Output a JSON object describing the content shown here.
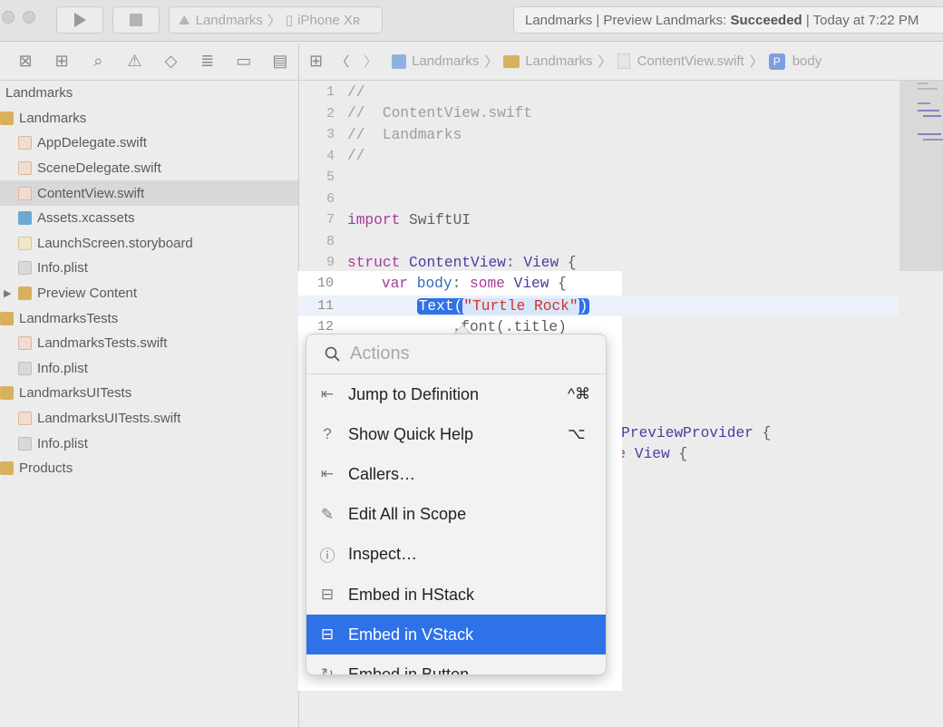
{
  "toolbar": {
    "run_icon": "play-icon",
    "stop_icon": "stop-icon",
    "scheme": "Landmarks",
    "device": "iPhone Xʀ",
    "activity_prefix": "Landmarks | Preview Landmarks: ",
    "activity_status": "Succeeded",
    "activity_suffix": " | Today at 7:22 PM"
  },
  "navigator_icons": [
    "folder-icon",
    "hierarchy-icon",
    "search-icon",
    "warning-icon",
    "test-icon",
    "debug-icon",
    "breakpoint-icon",
    "report-icon"
  ],
  "sidebar": {
    "items": [
      {
        "label": "Landmarks",
        "indent": 0,
        "icon": "project",
        "selected": false
      },
      {
        "label": "Landmarks",
        "indent": 0,
        "icon": "folder",
        "selected": false
      },
      {
        "label": "AppDelegate.swift",
        "indent": 1,
        "icon": "swift",
        "selected": false
      },
      {
        "label": "SceneDelegate.swift",
        "indent": 1,
        "icon": "swift",
        "selected": false
      },
      {
        "label": "ContentView.swift",
        "indent": 1,
        "icon": "swift",
        "selected": true
      },
      {
        "label": "Assets.xcassets",
        "indent": 1,
        "icon": "asset",
        "selected": false
      },
      {
        "label": "LaunchScreen.storyboard",
        "indent": 1,
        "icon": "story",
        "selected": false
      },
      {
        "label": "Info.plist",
        "indent": 1,
        "icon": "plist",
        "selected": false
      },
      {
        "label": "Preview Content",
        "indent": 1,
        "icon": "folder",
        "selected": false,
        "disclosure": "▶"
      },
      {
        "label": "LandmarksTests",
        "indent": 0,
        "icon": "folder",
        "selected": false
      },
      {
        "label": "LandmarksTests.swift",
        "indent": 1,
        "icon": "swift",
        "selected": false
      },
      {
        "label": "Info.plist",
        "indent": 1,
        "icon": "plist",
        "selected": false
      },
      {
        "label": "LandmarksUITests",
        "indent": 0,
        "icon": "folder",
        "selected": false
      },
      {
        "label": "LandmarksUITests.swift",
        "indent": 1,
        "icon": "swift",
        "selected": false
      },
      {
        "label": "Info.plist",
        "indent": 1,
        "icon": "plist",
        "selected": false
      },
      {
        "label": "Products",
        "indent": 0,
        "icon": "folder",
        "selected": false
      }
    ]
  },
  "jumpbar": {
    "crumbs": [
      "Landmarks",
      "Landmarks",
      "ContentView.swift",
      "body"
    ]
  },
  "code": {
    "dimmed_lines": [
      {
        "n": "1",
        "text": "//"
      },
      {
        "n": "2",
        "text": "//  ContentView.swift"
      },
      {
        "n": "3",
        "text": "//  Landmarks"
      },
      {
        "n": "4",
        "text": "//"
      },
      {
        "n": "5",
        "text": ""
      },
      {
        "n": "6",
        "text": ""
      },
      {
        "n": "7",
        "kw": "import",
        "rest": " SwiftUI"
      },
      {
        "n": "8",
        "text": ""
      },
      {
        "n": "9",
        "kw": "struct",
        "ty": " ContentView",
        "rest": ": ",
        "ty2": "View",
        " tail": " {"
      }
    ],
    "line10": {
      "n": "10",
      "pre": "    ",
      "kw": "var",
      "id": " body",
      "mid": ": ",
      "kw2": "some",
      "ty": " View",
      "tail": " {"
    },
    "line11": {
      "n": "11",
      "pre": "        ",
      "call": "Text(",
      "str": "\"Turtle Rock\"",
      "close": ")"
    },
    "line12": {
      "n": "12",
      "pre": "            ",
      "text": ".font(.title)"
    },
    "right_fragment_1": ": PreviewProvider {",
    "right_fragment_2": "ome View {"
  },
  "popup": {
    "search_placeholder": "Actions",
    "items": [
      {
        "label": "Jump to Definition",
        "shortcut": "^⌘",
        "icon": "jump-icon",
        "glyph": "⇤",
        "highlighted": false
      },
      {
        "label": "Show Quick Help",
        "shortcut": "⌥",
        "icon": "help-icon",
        "glyph": "?",
        "highlighted": false
      },
      {
        "label": "Callers…",
        "shortcut": "",
        "icon": "callers-icon",
        "glyph": "⇤",
        "highlighted": false
      },
      {
        "label": "Edit All in Scope",
        "shortcut": "",
        "icon": "edit-scope-icon",
        "glyph": "✎",
        "highlighted": false
      },
      {
        "label": "Inspect…",
        "shortcut": "",
        "icon": "info-icon",
        "glyph": "ⓘ",
        "highlighted": false
      },
      {
        "label": "Embed in HStack",
        "shortcut": "",
        "icon": "hstack-icon",
        "glyph": "⊟",
        "highlighted": false
      },
      {
        "label": "Embed in VStack",
        "shortcut": "",
        "icon": "vstack-icon",
        "glyph": "⊟",
        "highlighted": true
      },
      {
        "label": "Embed in Button",
        "shortcut": "",
        "icon": "button-icon",
        "glyph": "↻",
        "highlighted": false
      }
    ]
  }
}
